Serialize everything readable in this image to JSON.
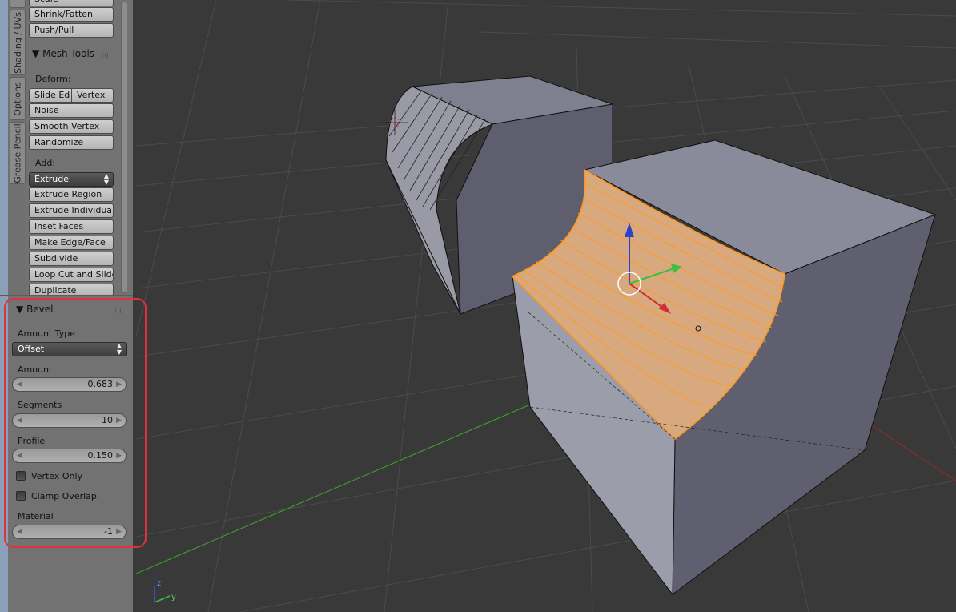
{
  "side_tabs": [
    "Shading / UVs",
    "Options",
    "Grease Pencil"
  ],
  "transform_buttons": [
    "Scale",
    "Shrink/Fatten",
    "Push/Pull"
  ],
  "mesh_tools": {
    "title": "Mesh Tools",
    "deform_label": "Deform:",
    "slide_edge": "Slide Ed",
    "vertex": "Vertex",
    "noise": "Noise",
    "smooth_vertex": "Smooth Vertex",
    "randomize": "Randomize",
    "add_label": "Add:",
    "extrude": "Extrude",
    "extrude_region": "Extrude Region",
    "extrude_individual": "Extrude Individual",
    "inset_faces": "Inset Faces",
    "make_edge_face": "Make Edge/Face",
    "subdivide": "Subdivide",
    "loop_cut_slide": "Loop Cut and Slide",
    "duplicate": "Duplicate"
  },
  "bevel": {
    "title": "Bevel",
    "amount_type_label": "Amount Type",
    "amount_type_value": "Offset",
    "amount_label": "Amount",
    "amount_value": "0.683",
    "segments_label": "Segments",
    "segments_value": "10",
    "profile_label": "Profile",
    "profile_value": "0.150",
    "vertex_only_label": "Vertex Only",
    "vertex_only_checked": false,
    "clamp_overlap_label": "Clamp Overlap",
    "clamp_overlap_checked": false,
    "material_label": "Material",
    "material_value": "-1"
  },
  "axis_gizmo": {
    "z": "z",
    "y": "y"
  },
  "colors": {
    "viewport_bg": "#393939",
    "grid": "#4a4a4a",
    "x_axis": "#9a2a2a",
    "y_axis": "#3a8a2a",
    "selection_orange": "#ff9a1f",
    "selected_face": "#d9aa80",
    "mesh_face": "#8b8c9c",
    "annotation_red": "#e0323a"
  }
}
